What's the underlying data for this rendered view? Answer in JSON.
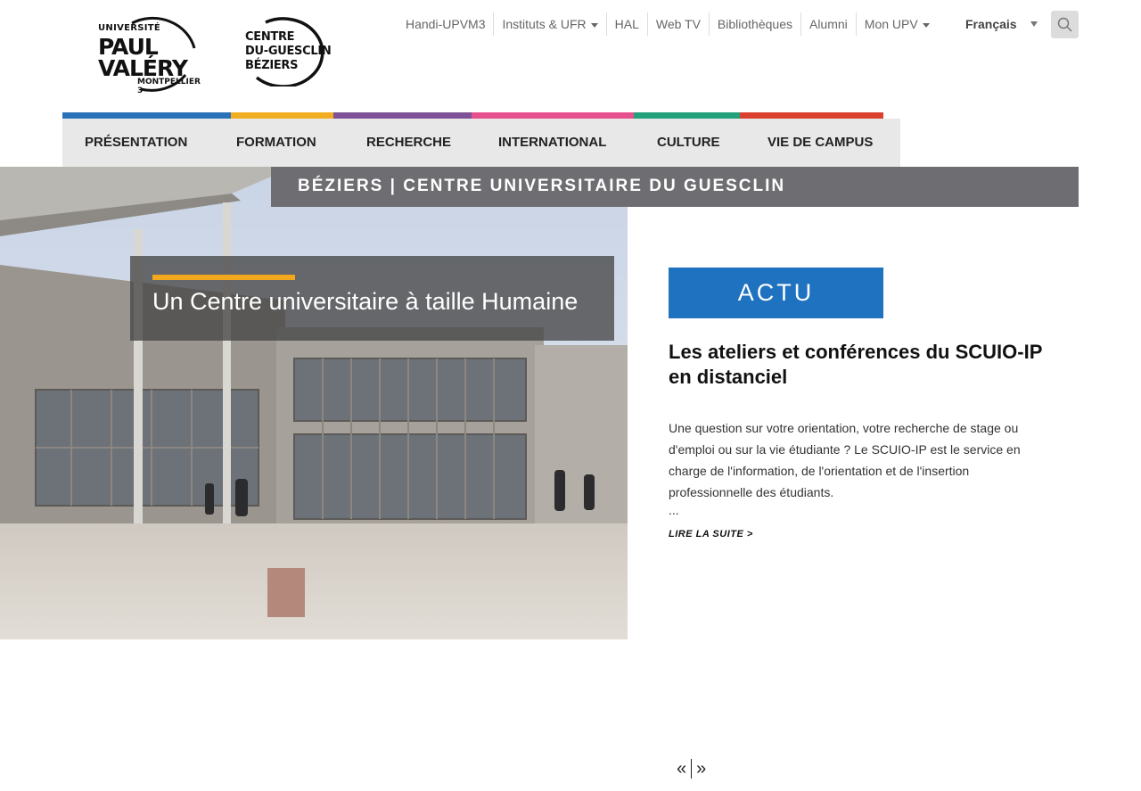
{
  "logos": {
    "upv": {
      "line1": "UNIVERSITÉ",
      "line2": "PAUL",
      "line3": "VALÉRY",
      "line4": "MONTPELLIER 3"
    },
    "centre": {
      "line1": "CENTRE",
      "line2": "DU-GUESCLIN",
      "line3": "BÉZIERS"
    }
  },
  "topnav": {
    "items": [
      "Handi-UPVM3",
      "Instituts & UFR",
      "HAL",
      "Web TV",
      "Bibliothèques",
      "Alumni",
      "Mon UPV"
    ],
    "language": "Français"
  },
  "mainmenu": {
    "items": [
      "Présentation",
      "Formation",
      "Recherche",
      "International",
      "Culture",
      "Vie de campus"
    ],
    "colors": [
      "#2a72b8",
      "#f1ae23",
      "#7e5296",
      "#e6508c",
      "#22a17b",
      "#d9412e"
    ]
  },
  "page_band": "BÉZIERS | CENTRE UNIVERSITAIRE DU GUESCLIN",
  "hero": {
    "caption": "Un Centre universitaire à taille Humaine"
  },
  "news": {
    "section_label": "ACTU",
    "title": "Les ateliers et conférences du SCUIO-IP en distanciel",
    "body": "Une question sur votre orientation, votre recherche de stage ou d'emploi ou sur la vie étudiante ? Le SCUIO-IP est le service en charge de l'information, de l'orientation et de l'insertion professionnelle des étudiants.",
    "ellipsis": "...",
    "read_more": "LIRE LA SUITE   >"
  },
  "pager": {
    "prev": "«",
    "next": "»"
  }
}
